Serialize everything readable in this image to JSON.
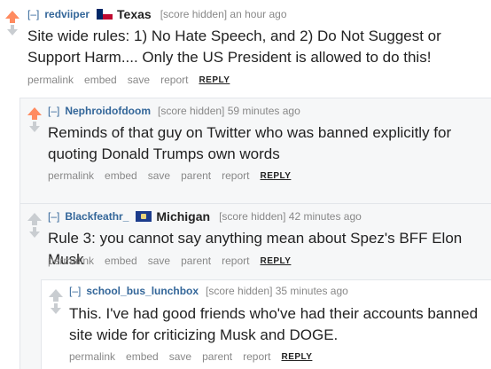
{
  "comments": [
    {
      "toggle": "[–]",
      "author": "redviiper",
      "flair": "Texas",
      "score": "[score hidden] an hour ago",
      "body": "Site wide rules: 1) No Hate Speech, and 2) Do Not Suggest or Support Harm.... Only the US President is allowed to do this!",
      "buttons": [
        "permalink",
        "embed",
        "save",
        "report",
        "REPLY"
      ]
    },
    {
      "toggle": "[–]",
      "author": "Nephroidofdoom",
      "score": "[score hidden] 59 minutes ago",
      "body": "Reminds of that guy on Twitter who was banned explicitly for quoting Donald Trumps own words",
      "buttons": [
        "permalink",
        "embed",
        "save",
        "parent",
        "report",
        "REPLY"
      ]
    },
    {
      "toggle": "[–]",
      "author": "Blackfeathr_",
      "flair": "Michigan",
      "score": "[score hidden] 42 minutes ago",
      "body": "Rule 3: you cannot say anything mean about Spez's BFF Elon Musk",
      "buttons": [
        "permalink",
        "embed",
        "save",
        "parent",
        "report",
        "REPLY"
      ]
    },
    {
      "toggle": "[–]",
      "author": "school_bus_lunchbox",
      "score": "[score hidden] 35 minutes ago",
      "body": "This. I've had good friends who've had their accounts banned site wide for criticizing Musk and DOGE.",
      "buttons": [
        "permalink",
        "embed",
        "save",
        "parent",
        "report",
        "REPLY"
      ]
    }
  ]
}
